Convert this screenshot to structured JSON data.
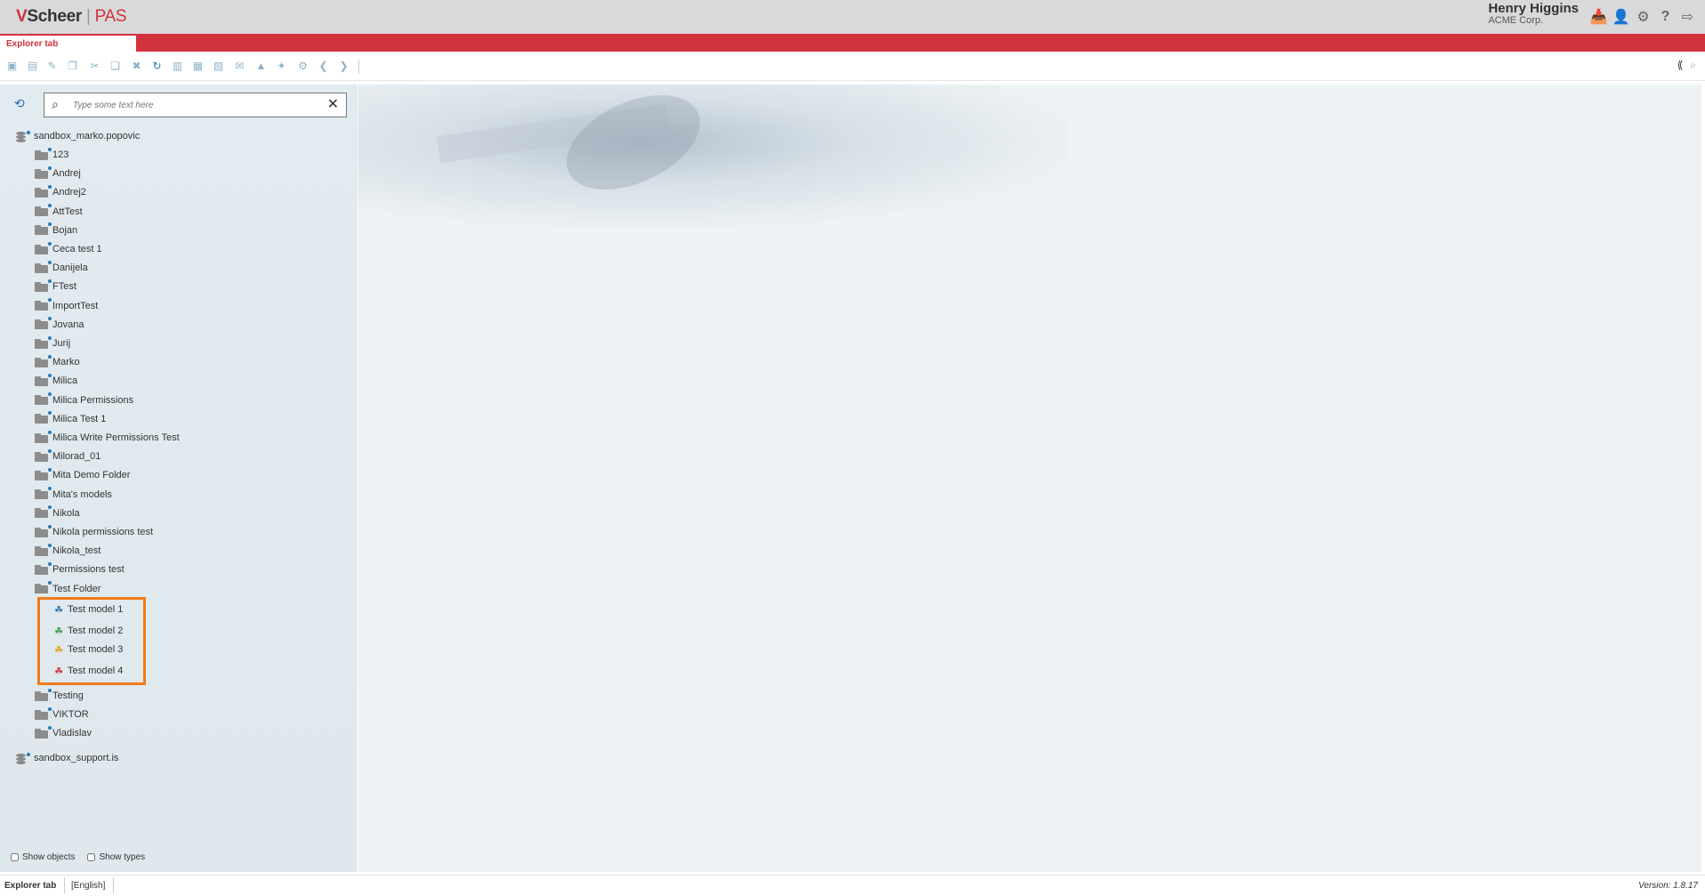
{
  "header": {
    "logo_mark": "V",
    "logo_brand": "Scheer",
    "logo_sep": "|",
    "logo_product": "PAS",
    "user_name": "Henry Higgins",
    "user_org": "ACME Corp.",
    "icons": [
      "inbox-icon",
      "user-icon",
      "gear-icon",
      "help-icon",
      "logout-icon"
    ]
  },
  "tabs": {
    "active": "Explorer tab"
  },
  "toolbar": {
    "icons": [
      "new-folder-icon",
      "new-model-icon",
      "edit-icon",
      "copy-icon",
      "cut-icon",
      "paste-icon",
      "delete-icon",
      "refresh-icon",
      "export-icon",
      "import-icon",
      "properties-icon",
      "share-icon",
      "pin-icon",
      "expand-icon",
      "settings-icon",
      "back-icon",
      "forward-icon"
    ]
  },
  "search": {
    "placeholder": "Type some text here",
    "value": ""
  },
  "tree": {
    "root1": "sandbox_marko.popovic",
    "folders": [
      "123",
      "Andrej",
      "Andrej2",
      "AttTest",
      "Bojan",
      "Ceca test 1",
      "Danijela",
      "FTest",
      "ImportTest",
      "Jovana",
      "Jurij",
      "Marko",
      "Milica",
      "Milica Permissions",
      "Milica Test 1",
      "Milica Write Permissions Test",
      "Milorad_01",
      "Mita Demo Folder",
      "Mita's models",
      "Nikola",
      "Nikola permissions test",
      "Nikola_test",
      "Permissions test",
      "Test Folder"
    ],
    "models": [
      "Test model 1",
      "Test model 2",
      "Test model 3",
      "Test model 4"
    ],
    "folders_after": [
      "Testing",
      "VIKTOR",
      "Vladislav"
    ],
    "root2": "sandbox_support.is"
  },
  "options": {
    "show_objects": "Show objects",
    "show_types": "Show types"
  },
  "footer": {
    "tab": "Explorer tab",
    "language": "[English]",
    "version": "Version: 1.8.17"
  },
  "colors": {
    "brand_red": "#d1323c",
    "highlight_orange": "#f07a1a",
    "toolbar_blue": "#8eb3c9"
  }
}
